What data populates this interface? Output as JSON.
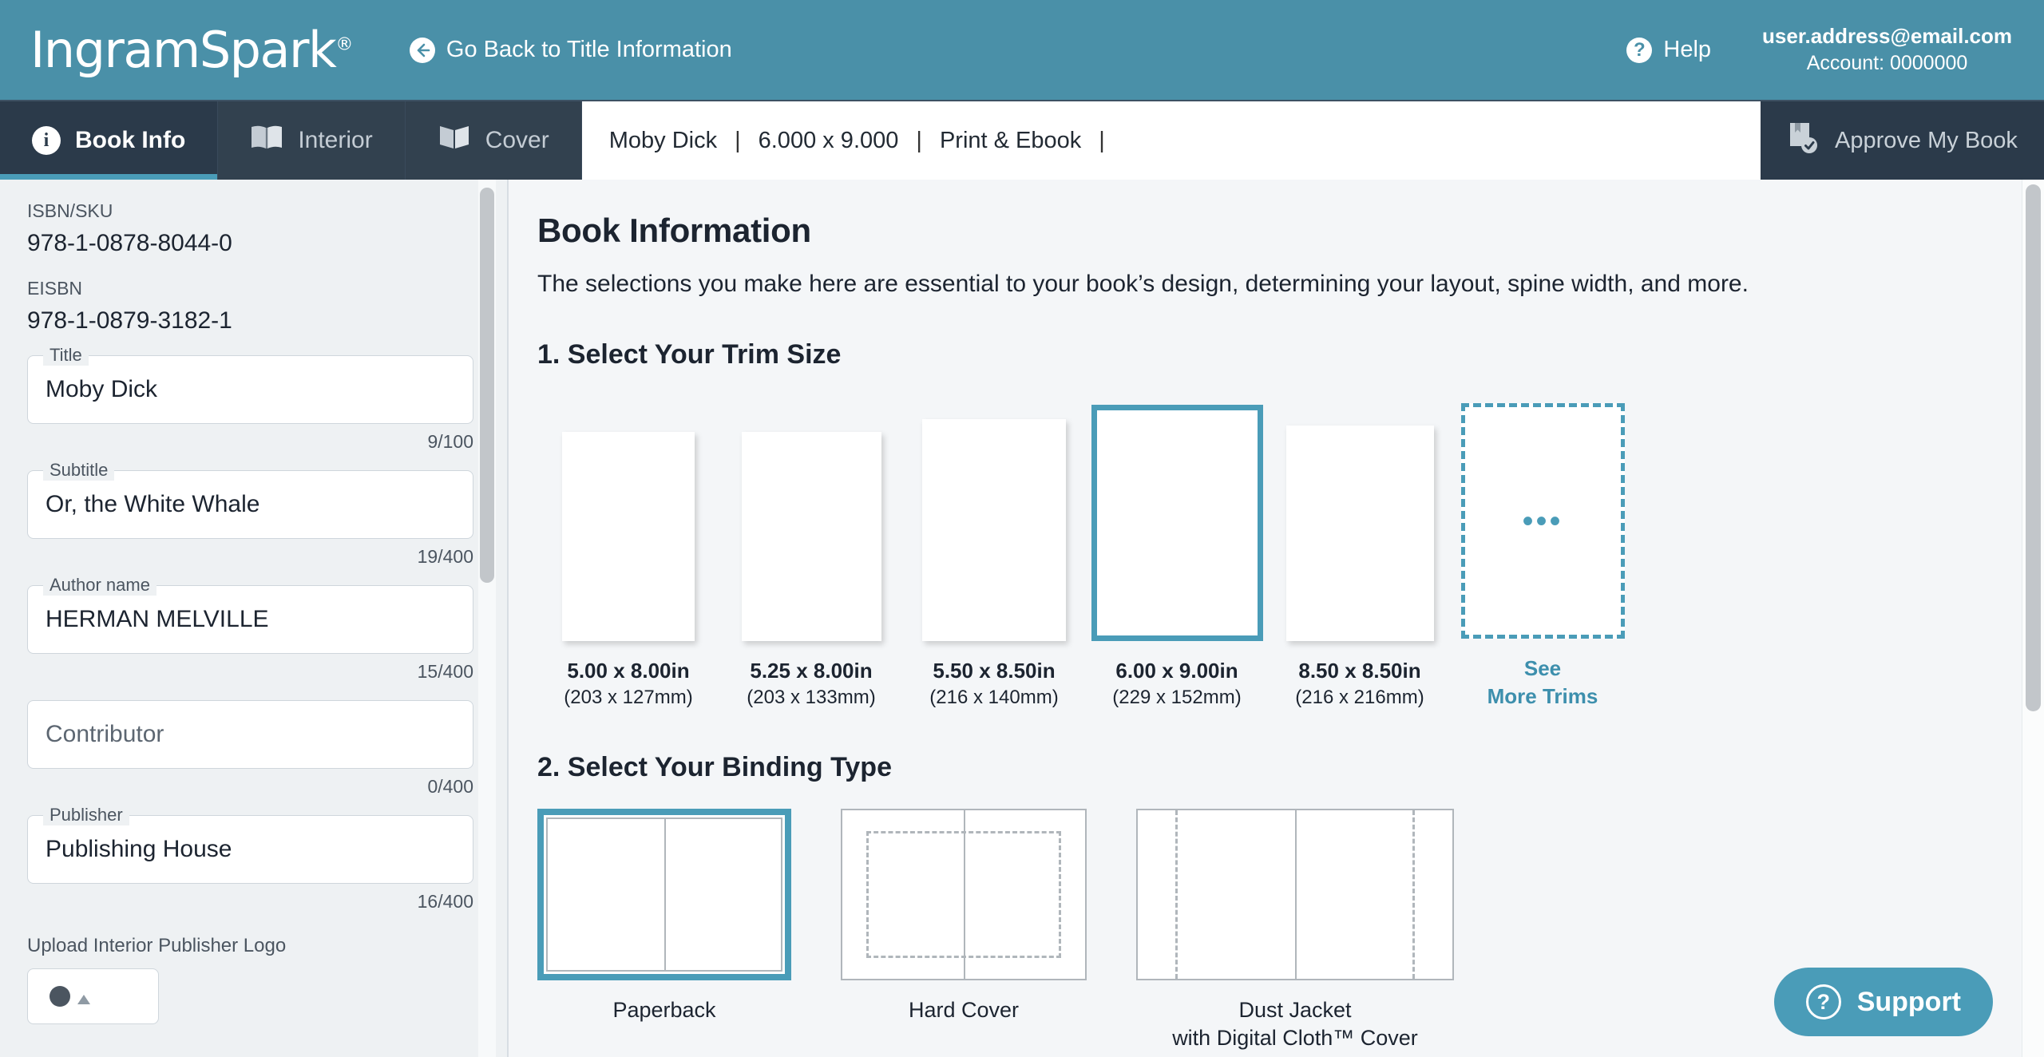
{
  "brand": {
    "name": "IngramSpark",
    "registered_mark": "®"
  },
  "header": {
    "go_back_label": "Go Back to Title Information",
    "go_back_icon": "arrow-left-circle-icon",
    "help_label": "Help",
    "help_icon": "question-circle-icon",
    "account_email": "user.address@email.com",
    "account_number": "Account: 0000000"
  },
  "nav": {
    "tabs": [
      {
        "label": "Book Info",
        "icon": "info-circle-icon",
        "active": true
      },
      {
        "label": "Interior",
        "icon": "open-book-icon",
        "active": false
      },
      {
        "label": "Cover",
        "icon": "closed-book-icon",
        "active": false
      }
    ],
    "breadcrumb": {
      "title": "Moby Dick",
      "trim": "6.000 x 9.000",
      "format": "Print & Ebook",
      "separator": "|"
    },
    "approve_label": "Approve My Book",
    "approve_icon": "book-check-icon"
  },
  "sidebar": {
    "isbn_label": "ISBN/SKU",
    "isbn_value": "978-1-0878-8044-0",
    "eisbn_label": "EISBN",
    "eisbn_value": "978-1-0879-3182-1",
    "fields": [
      {
        "legend": "Title",
        "value": "Moby Dick",
        "placeholder": "",
        "counter": "9/100"
      },
      {
        "legend": "Subtitle",
        "value": "Or, the White Whale",
        "placeholder": "",
        "counter": "19/400"
      },
      {
        "legend": "Author name",
        "value": "HERMAN MELVILLE",
        "placeholder": "",
        "counter": "15/400"
      },
      {
        "legend": "",
        "value": "",
        "placeholder": "Contributor",
        "counter": "0/400"
      },
      {
        "legend": "Publisher",
        "value": "Publishing House",
        "placeholder": "",
        "counter": "16/400"
      }
    ],
    "upload_label": "Upload Interior Publisher Logo",
    "upload_button_icon": "upload-image-icon"
  },
  "main": {
    "title": "Book Information",
    "description": "The selections you make here are essential to your book’s design, determining your layout, spine width, and more.",
    "trim_section_title": "1. Select Your Trim Size",
    "trims": [
      {
        "label": "5.00 x 8.00in",
        "metric": "(203 x 127mm)",
        "selected": false,
        "more": false
      },
      {
        "label": "5.25 x 8.00in",
        "metric": "(203 x 133mm)",
        "selected": false,
        "more": false
      },
      {
        "label": "5.50 x 8.50in",
        "metric": "(216 x 140mm)",
        "selected": false,
        "more": false
      },
      {
        "label": "6.00 x 9.00in",
        "metric": "(229 x 152mm)",
        "selected": true,
        "more": false
      },
      {
        "label": "8.50 x 8.50in",
        "metric": "(216 x 216mm)",
        "selected": false,
        "more": false
      },
      {
        "label": "See",
        "metric": "More Trims",
        "selected": false,
        "more": true
      }
    ],
    "binding_section_title": "2. Select Your Binding Type",
    "bindings": [
      {
        "label": "Paperback",
        "sublabel": "",
        "selected": true,
        "style": "plain"
      },
      {
        "label": "Hard Cover",
        "sublabel": "",
        "selected": false,
        "style": "dashed-inset"
      },
      {
        "label": "Dust Jacket",
        "sublabel": "with Digital Cloth™ Cover",
        "selected": false,
        "style": "flaps"
      }
    ],
    "support_label": "Support",
    "support_icon": "question-circle-icon"
  },
  "colors": {
    "brand_teal": "#4a90a8",
    "accent_teal": "#4a9cb8",
    "nav_dark": "#2b3a4a",
    "page_bg": "#f4f6f8",
    "sidebar_bg": "#eef1f3"
  }
}
